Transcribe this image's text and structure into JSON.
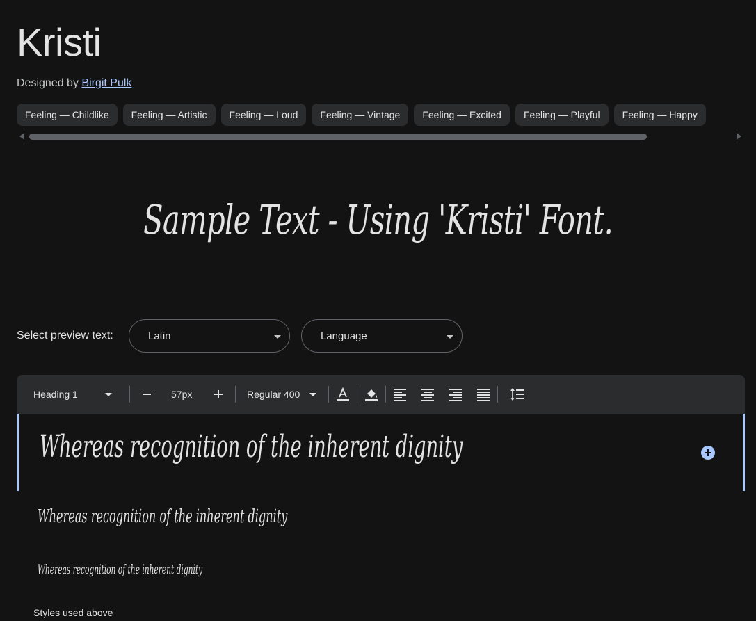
{
  "font": {
    "name": "Kristi",
    "designed_by_prefix": "Designed by",
    "designer": "Birgit Pulk"
  },
  "tags": [
    "Feeling — Childlike",
    "Feeling — Artistic",
    "Feeling — Loud",
    "Feeling — Vintage",
    "Feeling — Excited",
    "Feeling — Playful",
    "Feeling — Happy"
  ],
  "sample_text": "Sample Text - Using 'Kristi' Font.",
  "preview": {
    "label": "Select preview text:",
    "script_select": "Latin",
    "language_select": "Language"
  },
  "toolbar": {
    "style": "Heading 1",
    "size": "57px",
    "weight": "Regular 400",
    "icons": [
      "minus-icon",
      "plus-icon",
      "text-color-icon",
      "highlight-color-icon",
      "align-left-icon",
      "align-center-icon",
      "align-right-icon",
      "align-justify-icon",
      "line-spacing-icon"
    ]
  },
  "editor": {
    "heading_1_text": "Whereas recognition of the inherent dignity",
    "heading_2_text": "Whereas recognition of the inherent dignity",
    "heading_3_text": "Whereas recognition of the inherent dignity"
  },
  "styles_used_label": "Styles used above",
  "colors": {
    "background": "#131314",
    "surface": "#2b2c2e",
    "accent": "#a8c7fa",
    "text": "#e3e3e3"
  }
}
